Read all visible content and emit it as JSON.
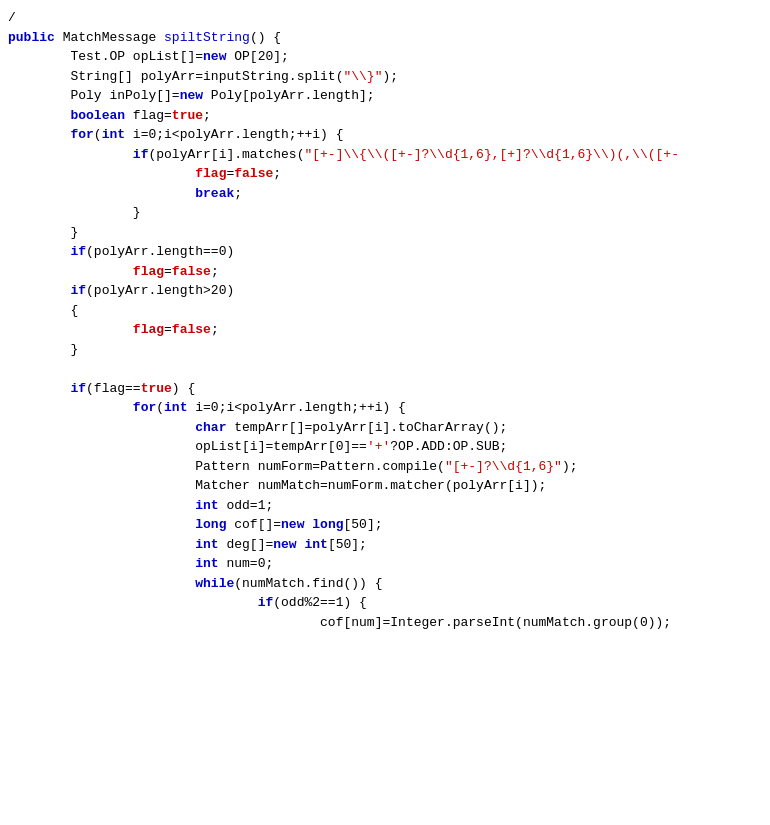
{
  "code": {
    "lines": [
      {
        "id": 1,
        "html": "<span class='plain'>/</span>"
      },
      {
        "id": 2,
        "html": "<span class='kw'>public</span> <span class='plain'>MatchMessage </span><span class='method-name'>spiltString</span><span class='plain'>() {</span>"
      },
      {
        "id": 3,
        "html": "        <span class='plain'>Test.OP opList[]=</span><span class='kw'>new</span><span class='plain'> OP[20];</span>"
      },
      {
        "id": 4,
        "html": "        <span class='plain'>String[] polyArr=inputString.split(</span><span class='str'>\"\\\\}\"</span><span class='plain'>);</span>"
      },
      {
        "id": 5,
        "html": "        <span class='plain'>Poly inPoly[]=</span><span class='kw'>new</span><span class='plain'> Poly[polyArr.length];</span>"
      },
      {
        "id": 6,
        "html": "        <span class='type'>boolean</span><span class='plain'> flag=</span><span class='kw2'>true</span><span class='plain'>;</span>"
      },
      {
        "id": 7,
        "html": "        <span class='kw'>for</span><span class='plain'>(</span><span class='type'>int</span><span class='plain'> i=0;i&lt;polyArr.length;++i) {</span>"
      },
      {
        "id": 8,
        "html": "                <span class='kw'>if</span><span class='plain'>(polyArr[i].matches(</span><span class='str'>\"[+-]\\\\{\\\\([+-]?\\\\d{1,6},[+]?\\\\d{1,6}\\\\)(,\\\\([+-</span>"
      },
      {
        "id": 9,
        "html": "                        <span class='kw2'>flag</span><span class='plain'>=</span><span class='kw2'>false</span><span class='plain'>;</span>"
      },
      {
        "id": 10,
        "html": "                        <span class='kw'>break</span><span class='plain'>;</span>"
      },
      {
        "id": 11,
        "html": "                <span class='plain'>}</span>"
      },
      {
        "id": 12,
        "html": "        <span class='plain'>}</span>"
      },
      {
        "id": 13,
        "html": "        <span class='kw'>if</span><span class='plain'>(polyArr.length==0)</span>"
      },
      {
        "id": 14,
        "html": "                <span class='kw2'>flag</span><span class='plain'>=</span><span class='kw2'>false</span><span class='plain'>;</span>"
      },
      {
        "id": 15,
        "html": "        <span class='kw'>if</span><span class='plain'>(polyArr.length&gt;20)</span>"
      },
      {
        "id": 16,
        "html": "        <span class='plain'>{</span>"
      },
      {
        "id": 17,
        "html": "                <span class='kw2'>flag</span><span class='plain'>=</span><span class='kw2'>false</span><span class='plain'>;</span>"
      },
      {
        "id": 18,
        "html": "        <span class='plain'>}</span>"
      },
      {
        "id": 19,
        "html": ""
      },
      {
        "id": 20,
        "html": "        <span class='kw'>if</span><span class='plain'>(flag==</span><span class='kw2'>true</span><span class='plain'>) {</span>"
      },
      {
        "id": 21,
        "html": "                <span class='kw'>for</span><span class='plain'>(</span><span class='type'>int</span><span class='plain'> i=0;i&lt;polyArr.length;++i) {</span>"
      },
      {
        "id": 22,
        "html": "                        <span class='type'>char</span><span class='plain'> tempArr[]=polyArr[i].toCharArray();</span>"
      },
      {
        "id": 23,
        "html": "                        <span class='plain'>opList[i]=tempArr[0]==</span><span class='str'>'+'</span><span class='plain'>?OP.ADD:OP.SUB;</span>"
      },
      {
        "id": 24,
        "html": "                        <span class='plain'>Pattern numForm=Pattern.compile(</span><span class='str'>\"[+-]?\\\\d{1,6}\"</span><span class='plain'>);</span>"
      },
      {
        "id": 25,
        "html": "                        <span class='plain'>Matcher numMatch=numForm.matcher(polyArr[i]);</span>"
      },
      {
        "id": 26,
        "html": "                        <span class='type'>int</span><span class='plain'> odd=1;</span>"
      },
      {
        "id": 27,
        "html": "                        <span class='type'>long</span><span class='plain'> cof[]=</span><span class='kw'>new</span><span class='plain'> </span><span class='type'>long</span><span class='plain'>[50];</span>"
      },
      {
        "id": 28,
        "html": "                        <span class='type'>int</span><span class='plain'> deg[]=</span><span class='kw'>new</span><span class='plain'> </span><span class='type'>int</span><span class='plain'>[50];</span>"
      },
      {
        "id": 29,
        "html": "                        <span class='type'>int</span><span class='plain'> num=0;</span>"
      },
      {
        "id": 30,
        "html": "                        <span class='kw'>while</span><span class='plain'>(numMatch.find()) {</span>"
      },
      {
        "id": 31,
        "html": "                                <span class='kw'>if</span><span class='plain'>(odd%2==1) {</span>"
      },
      {
        "id": 32,
        "html": "                                        <span class='plain'>cof[num]=Integer.parseInt(numMatch.group(0));</span>"
      }
    ]
  }
}
